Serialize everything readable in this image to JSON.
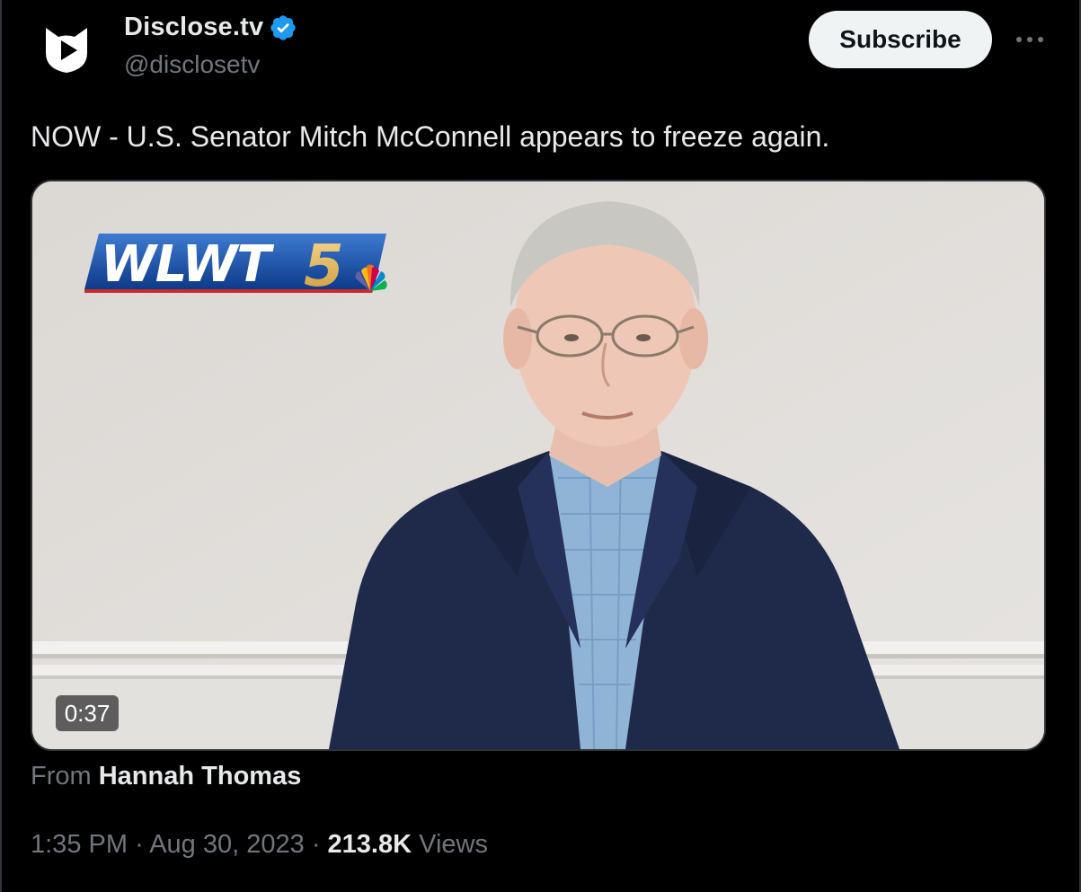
{
  "author": {
    "display_name": "Disclose.tv",
    "handle": "@disclosetv",
    "verified": true,
    "avatar_icon": "play-cat-icon"
  },
  "header": {
    "subscribe_label": "Subscribe",
    "more_icon": "more-horizontal-icon"
  },
  "tweet": {
    "text": "NOW - U.S. Senator Mitch McConnell appears to freeze again."
  },
  "media": {
    "type": "video",
    "duration": "0:37",
    "logo_text": "WLWT5"
  },
  "source": {
    "prefix": "From",
    "name": "Hannah Thomas"
  },
  "meta": {
    "time": "1:35 PM",
    "separator": "·",
    "date": "Aug 30, 2023",
    "views_count": "213.8K",
    "views_label": "Views"
  },
  "colors": {
    "background": "#000000",
    "text_primary": "#e7e9ea",
    "text_secondary": "#71767b",
    "verified": "#1d9bf0",
    "subscribe_bg": "#eff3f4"
  }
}
